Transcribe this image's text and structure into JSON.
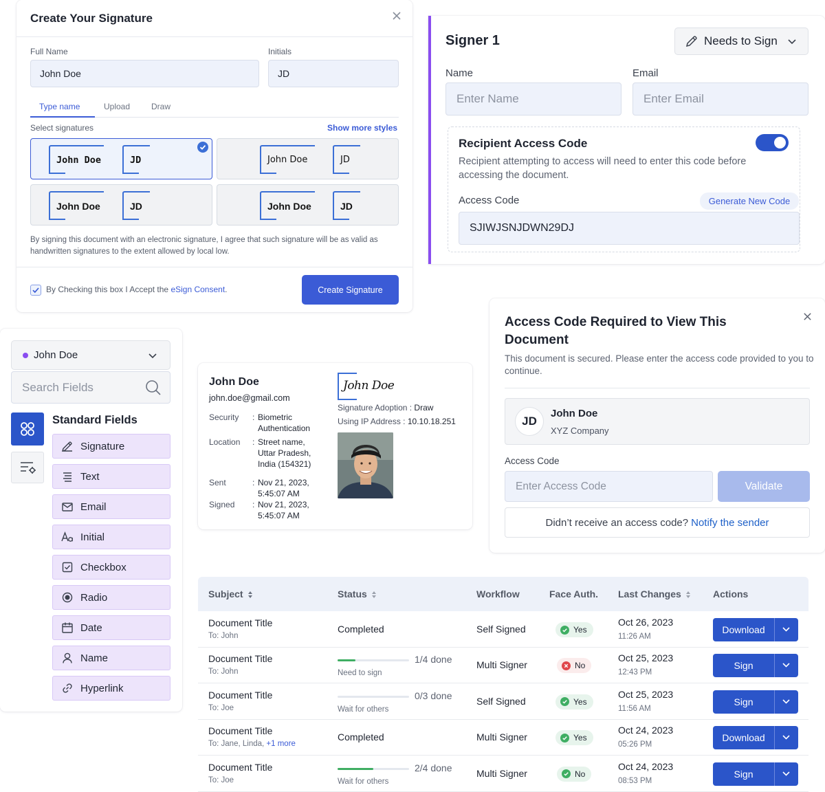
{
  "signature_modal": {
    "title": "Create Your Signature",
    "full_name_label": "Full Name",
    "full_name_value": "John Doe",
    "initials_label": "Initials",
    "initials_value": "JD",
    "tabs": [
      "Type name",
      "Upload",
      "Draw"
    ],
    "select_label": "Select signatures",
    "show_more": "Show more styles",
    "options": [
      {
        "name": "John Doe",
        "initials": "JD"
      },
      {
        "name": "John Doe",
        "initials": "JD"
      },
      {
        "name": "John Doe",
        "initials": "JD"
      },
      {
        "name": "John Doe",
        "initials": "JD"
      }
    ],
    "disclaimer": "By signing this document with an electronic signature, I agree that such signature will be as valid as handwritten signatures to the extent allowed by local low.",
    "consent_prefix": "By Checking this box I Accept the ",
    "consent_link": "eSign Consent",
    "consent_suffix": ".",
    "create_button": "Create Signature"
  },
  "signer": {
    "title": "Signer 1",
    "role": "Needs to Sign",
    "name_label": "Name",
    "name_placeholder": "Enter Name",
    "email_label": "Email",
    "email_placeholder": "Enter Email",
    "rac_title": "Recipient Access Code",
    "rac_desc": "Recipient attempting to access will need to enter this code before accessing the document.",
    "code_label": "Access Code",
    "generate": "Generate New Code",
    "code_value": "SJIWJSNJDWN29DJ"
  },
  "fields_panel": {
    "user": "John Doe",
    "search_placeholder": "Search Fields",
    "section_title": "Standard Fields",
    "items": [
      {
        "label": "Signature",
        "icon": "pen-icon"
      },
      {
        "label": "Text",
        "icon": "text-icon"
      },
      {
        "label": "Email",
        "icon": "mail-icon"
      },
      {
        "label": "Initial",
        "icon": "initial-icon"
      },
      {
        "label": "Checkbox",
        "icon": "checkbox-icon"
      },
      {
        "label": "Radio",
        "icon": "radio-icon"
      },
      {
        "label": "Date",
        "icon": "calendar-icon"
      },
      {
        "label": "Name",
        "icon": "user-icon"
      },
      {
        "label": "Hyperlink",
        "icon": "link-icon"
      }
    ]
  },
  "audit": {
    "name": "John Doe",
    "email": "john.doe@gmail.com",
    "security_label": "Security",
    "security_value_1": "Biometric",
    "security_value_2": "Authentication",
    "location_label": "Location",
    "location_1": "Street name,",
    "location_2": "Uttar Pradesh,",
    "location_3": "India (154321)",
    "sent_label": "Sent",
    "sent_1": "Nov 21, 2023,",
    "sent_2": "5:45:07 AM",
    "signed_label": "Signed",
    "signed_1": "Nov 21, 2023,",
    "signed_2": "5:45:07 AM",
    "colon": ":",
    "signature_text": "John Doe",
    "adoption_label": "Signature Adoption : ",
    "adoption_value": "Draw",
    "ip_label": "Using IP Address : ",
    "ip_value": "10.10.18.251"
  },
  "access_modal": {
    "title_1": "Access Code Required to View This",
    "title_2": "Document",
    "desc": "This document is secured. Please enter the access code provided to you to continue.",
    "initials": "JD",
    "name": "John Doe",
    "company": "XYZ Company",
    "code_label": "Access Code",
    "code_placeholder": "Enter Access Code",
    "validate": "Validate",
    "notify_prefix": "Didn’t receive an access code? ",
    "notify_link": "Notify the sender"
  },
  "table": {
    "headers": {
      "subject": "Subject",
      "status": "Status",
      "workflow": "Workflow",
      "face": "Face Auth.",
      "last": "Last Changes",
      "actions": "Actions"
    },
    "rows": [
      {
        "title": "Document Title",
        "to": "To: John",
        "to_more": "",
        "status": "Completed",
        "progress_text": "",
        "progress": null,
        "status_sub": "",
        "workflow": "Self Signed",
        "face": "Yes",
        "date": "Oct 26, 2023",
        "time": "11:26 AM",
        "action": "Download"
      },
      {
        "title": "Document Title",
        "to": "To: John",
        "to_more": "",
        "status": "",
        "progress_text": "1/4 done",
        "progress": 0.25,
        "status_sub": "Need to sign",
        "workflow": "Multi Signer",
        "face": "No",
        "date": "Oct 25, 2023",
        "time": "12:43 PM",
        "action": "Sign"
      },
      {
        "title": "Document Title",
        "to": "To: Joe",
        "to_more": "",
        "status": "",
        "progress_text": "0/3 done",
        "progress": 0,
        "status_sub": "Wait for others",
        "workflow": "Self Signed",
        "face": "Yes",
        "date": "Oct 25, 2023",
        "time": "11:56 AM",
        "action": "Sign"
      },
      {
        "title": "Document Title",
        "to": "To: Jane, Linda, ",
        "to_more": "+1 more",
        "status": "Completed",
        "progress_text": "",
        "progress": null,
        "status_sub": "",
        "workflow": "Multi Signer",
        "face": "Yes",
        "date": "Oct 24, 2023",
        "time": "05:26 PM",
        "action": "Download"
      },
      {
        "title": "Document Title",
        "to": "To: Joe",
        "to_more": "",
        "status": "",
        "progress_text": "2/4 done",
        "progress": 0.5,
        "status_sub": "Wait for others",
        "workflow": "Multi Signer",
        "face": "No",
        "date": "Oct 24, 2023",
        "time": "08:53 PM",
        "action": "Sign"
      }
    ]
  },
  "colors": {
    "primary": "#3b5bd6",
    "purple_accent": "#8a4df0",
    "field_bg": "#ede4fb",
    "success": "#3fae63",
    "danger": "#e0474c"
  }
}
